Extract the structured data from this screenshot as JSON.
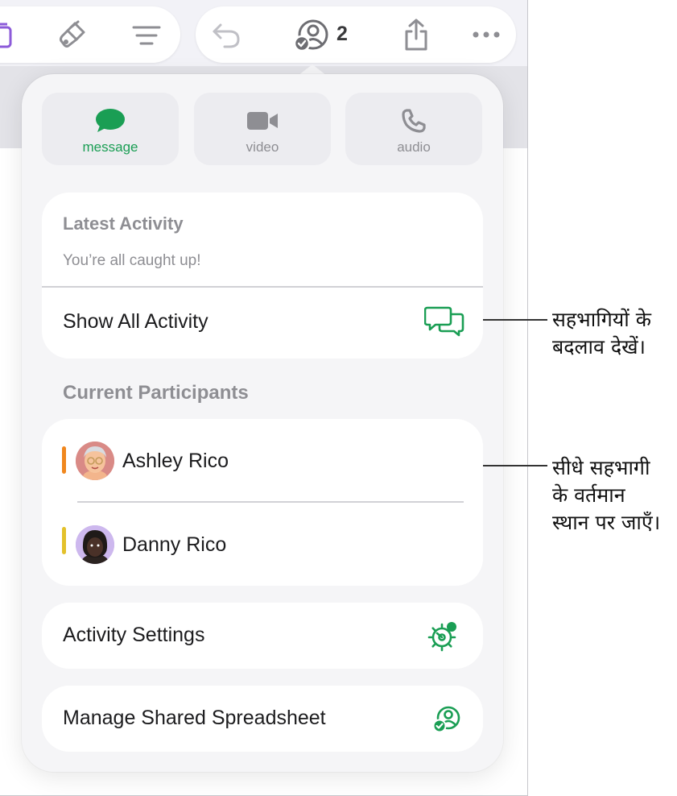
{
  "toolbar": {
    "collab_count": "2"
  },
  "communication": {
    "buttons": [
      {
        "label": "message",
        "icon": "message-bubble-icon",
        "active": true
      },
      {
        "label": "video",
        "icon": "video-camera-icon",
        "active": false
      },
      {
        "label": "audio",
        "icon": "phone-icon",
        "active": false
      }
    ]
  },
  "activity": {
    "heading": "Latest Activity",
    "status": "You’re all caught up!",
    "show_all_label": "Show All Activity"
  },
  "participants": {
    "heading": "Current Participants",
    "list": [
      {
        "name": "Ashley Rico",
        "color": "#f0871e"
      },
      {
        "name": "Danny Rico",
        "color": "#e3c12b"
      }
    ]
  },
  "settings": {
    "activity_settings_label": "Activity Settings",
    "manage_label": "Manage Shared Spreadsheet"
  },
  "callouts": {
    "changes": "सहभागियों के\nबदलाव देखें।",
    "jump": "सीधे सहभागी\nके वर्तमान\nस्थान पर जाएँ।"
  },
  "colors": {
    "accent_green": "#1a9e54",
    "toolbar_icon": "#8e8e93"
  }
}
